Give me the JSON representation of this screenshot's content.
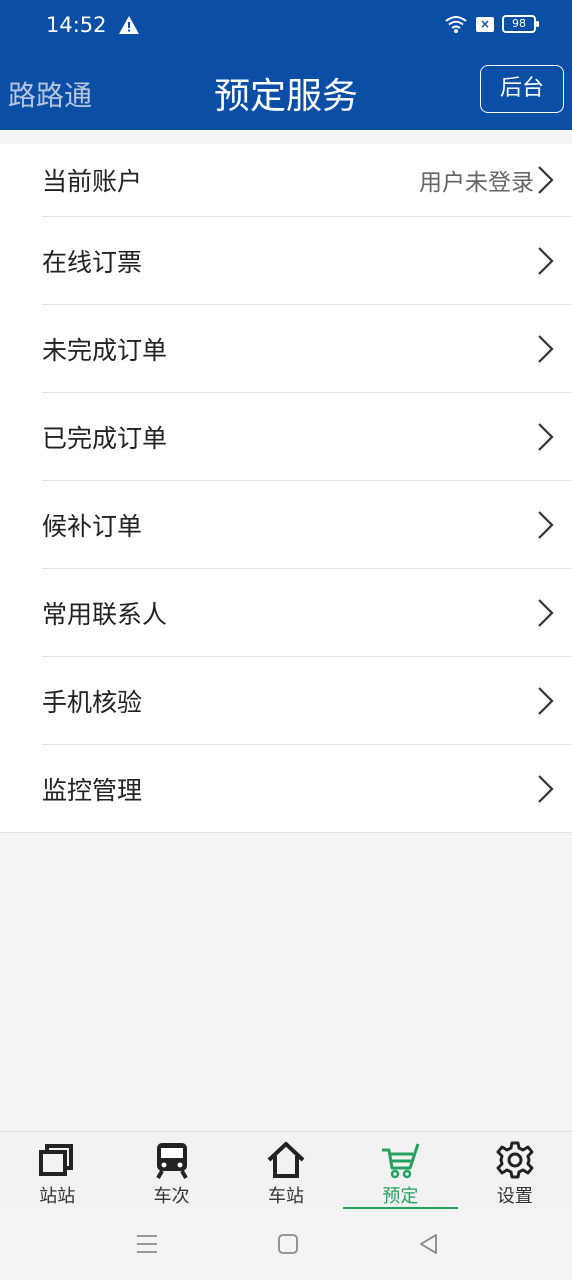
{
  "status": {
    "time": "14:52",
    "battery": "98"
  },
  "header": {
    "app_name": "路路通",
    "title": "预定服务",
    "admin_button": "后台"
  },
  "menu": {
    "items": [
      {
        "label": "当前账户",
        "value": "用户未登录"
      },
      {
        "label": "在线订票"
      },
      {
        "label": "未完成订单"
      },
      {
        "label": "已完成订单"
      },
      {
        "label": "候补订单"
      },
      {
        "label": "常用联系人"
      },
      {
        "label": "手机核验"
      },
      {
        "label": "监控管理"
      }
    ]
  },
  "bottom_nav": {
    "items": [
      {
        "label": "站站",
        "icon": "station-to-station-icon"
      },
      {
        "label": "车次",
        "icon": "train-icon"
      },
      {
        "label": "车站",
        "icon": "home-icon"
      },
      {
        "label": "预定",
        "icon": "cart-icon",
        "active": true
      },
      {
        "label": "设置",
        "icon": "gear-icon"
      }
    ]
  },
  "colors": {
    "primary": "#0a4fa5",
    "accent": "#25a15f"
  }
}
